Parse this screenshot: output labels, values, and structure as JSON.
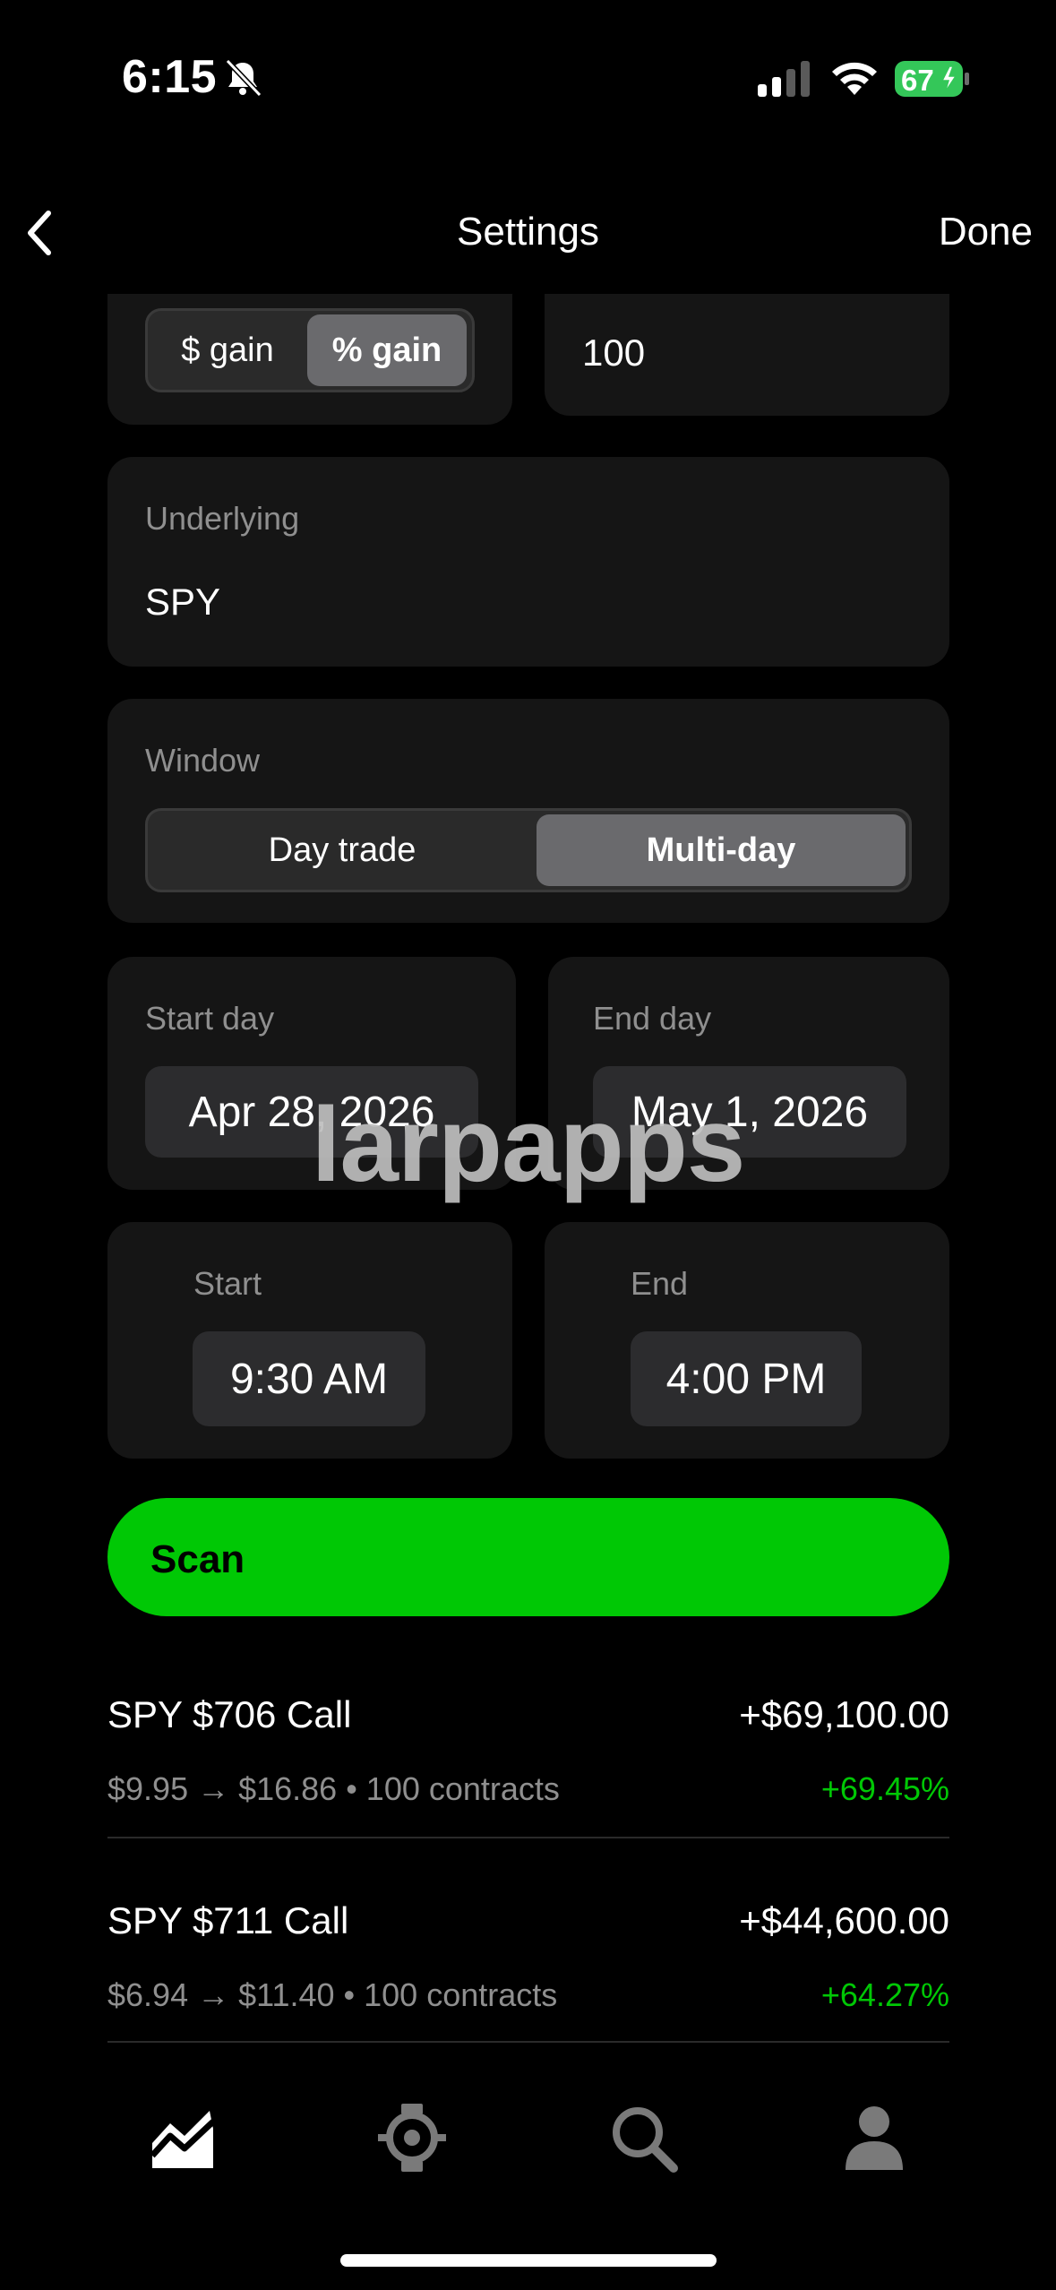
{
  "status_bar": {
    "time": "6:15",
    "battery": "67"
  },
  "nav": {
    "title": "Settings",
    "done_label": "Done"
  },
  "gain_mode": {
    "options": [
      "$ gain",
      "% gain"
    ],
    "selected": "% gain"
  },
  "threshold": {
    "value": "100"
  },
  "underlying": {
    "label": "Underlying",
    "value": "SPY"
  },
  "window": {
    "label": "Window",
    "options": [
      "Day trade",
      "Multi-day"
    ],
    "selected": "Multi-day"
  },
  "start_day": {
    "label": "Start day",
    "value": "Apr 28, 2026"
  },
  "end_day": {
    "label": "End day",
    "value": "May 1, 2026"
  },
  "start_time": {
    "label": "Start",
    "value": "9:30 AM"
  },
  "end_time": {
    "label": "End",
    "value": "4:00 PM"
  },
  "scan": {
    "label": "Scan"
  },
  "results": [
    {
      "title": "SPY $706 Call",
      "detail": "$9.95 → $16.86 • 100 contracts",
      "amount": "+$69,100.00",
      "percent": "+69.45%"
    },
    {
      "title": "SPY $711 Call",
      "detail": "$6.94 → $11.40 • 100 contracts",
      "amount": "+$44,600.00",
      "percent": "+64.27%"
    }
  ],
  "tabbar": {
    "items": [
      "chart-icon",
      "scanner-icon",
      "search-icon",
      "profile-icon"
    ]
  },
  "watermark": "larpapps",
  "colors": {
    "accent": "#00c805",
    "background": "#000000",
    "card": "#151515"
  }
}
